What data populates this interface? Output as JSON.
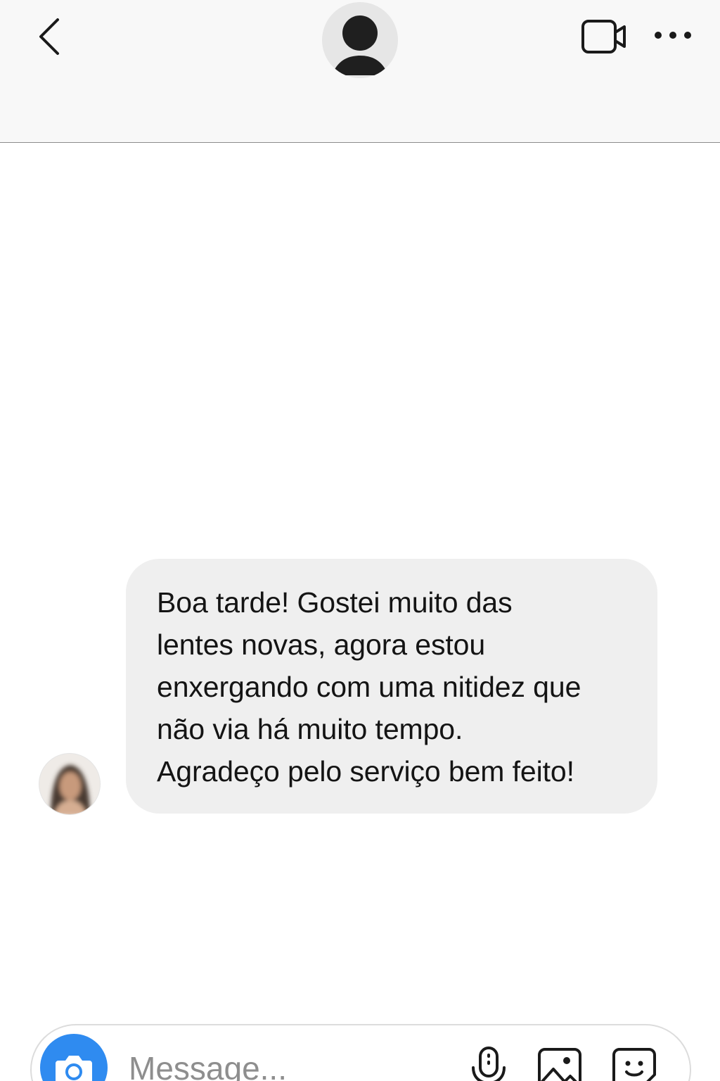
{
  "header": {
    "back_icon": "chevron-left-icon",
    "avatar_icon": "person-silhouette-icon",
    "video_icon": "video-camera-icon",
    "more_icon": "ellipsis-horizontal-icon"
  },
  "messages": [
    {
      "direction": "incoming",
      "avatar": "blurred-profile-photo",
      "text": "Boa tarde! Gostei muito das\nlentes novas, agora estou\nenxergando com uma nitidez que\nnão via há muito tempo.\nAgradeço pelo serviço bem feito!"
    }
  ],
  "composer": {
    "placeholder": "Message...",
    "camera_icon": "camera-icon",
    "mic_icon": "microphone-icon",
    "gallery_icon": "image-icon",
    "sticker_icon": "sticker-icon"
  },
  "colors": {
    "header_bg": "#f8f8f8",
    "bubble_bg": "#efefef",
    "accent_blue": "#2f8bf0",
    "icon": "#1a1a1a"
  }
}
